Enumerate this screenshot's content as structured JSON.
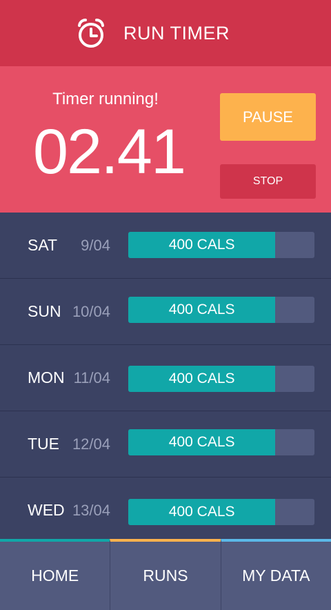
{
  "header": {
    "title": "RUN TIMER",
    "icon": "alarm-clock-icon"
  },
  "timer": {
    "status": "Timer running!",
    "value": "02.41"
  },
  "controls": {
    "pause_label": "PAUSE",
    "stop_label": "STOP"
  },
  "days": [
    {
      "day": "SAT",
      "date": "9/04",
      "label": "400 CALS",
      "fill_percent": 79
    },
    {
      "day": "SUN",
      "date": "10/04",
      "label": "400 CALS",
      "fill_percent": 79
    },
    {
      "day": "MON",
      "date": "11/04",
      "label": "400 CALS",
      "fill_percent": 79
    },
    {
      "day": "TUE",
      "date": "12/04",
      "label": "400 CALS",
      "fill_percent": 79
    },
    {
      "day": "WED",
      "date": "13/04",
      "label": "400 CALS",
      "fill_percent": 79
    }
  ],
  "nav": {
    "items": [
      {
        "label": "HOME",
        "accent": "#11a7a8"
      },
      {
        "label": "RUNS",
        "accent": "#fdb24d"
      },
      {
        "label": "MY DATA",
        "accent": "#5bb8e8"
      }
    ]
  },
  "colors": {
    "header": "#cf344b",
    "timer_panel": "#e64f66",
    "pause": "#fdb24d",
    "stop": "#cf344b",
    "list_bg": "#3b4263",
    "bar": "#11a7a8",
    "track": "#525a7e"
  }
}
